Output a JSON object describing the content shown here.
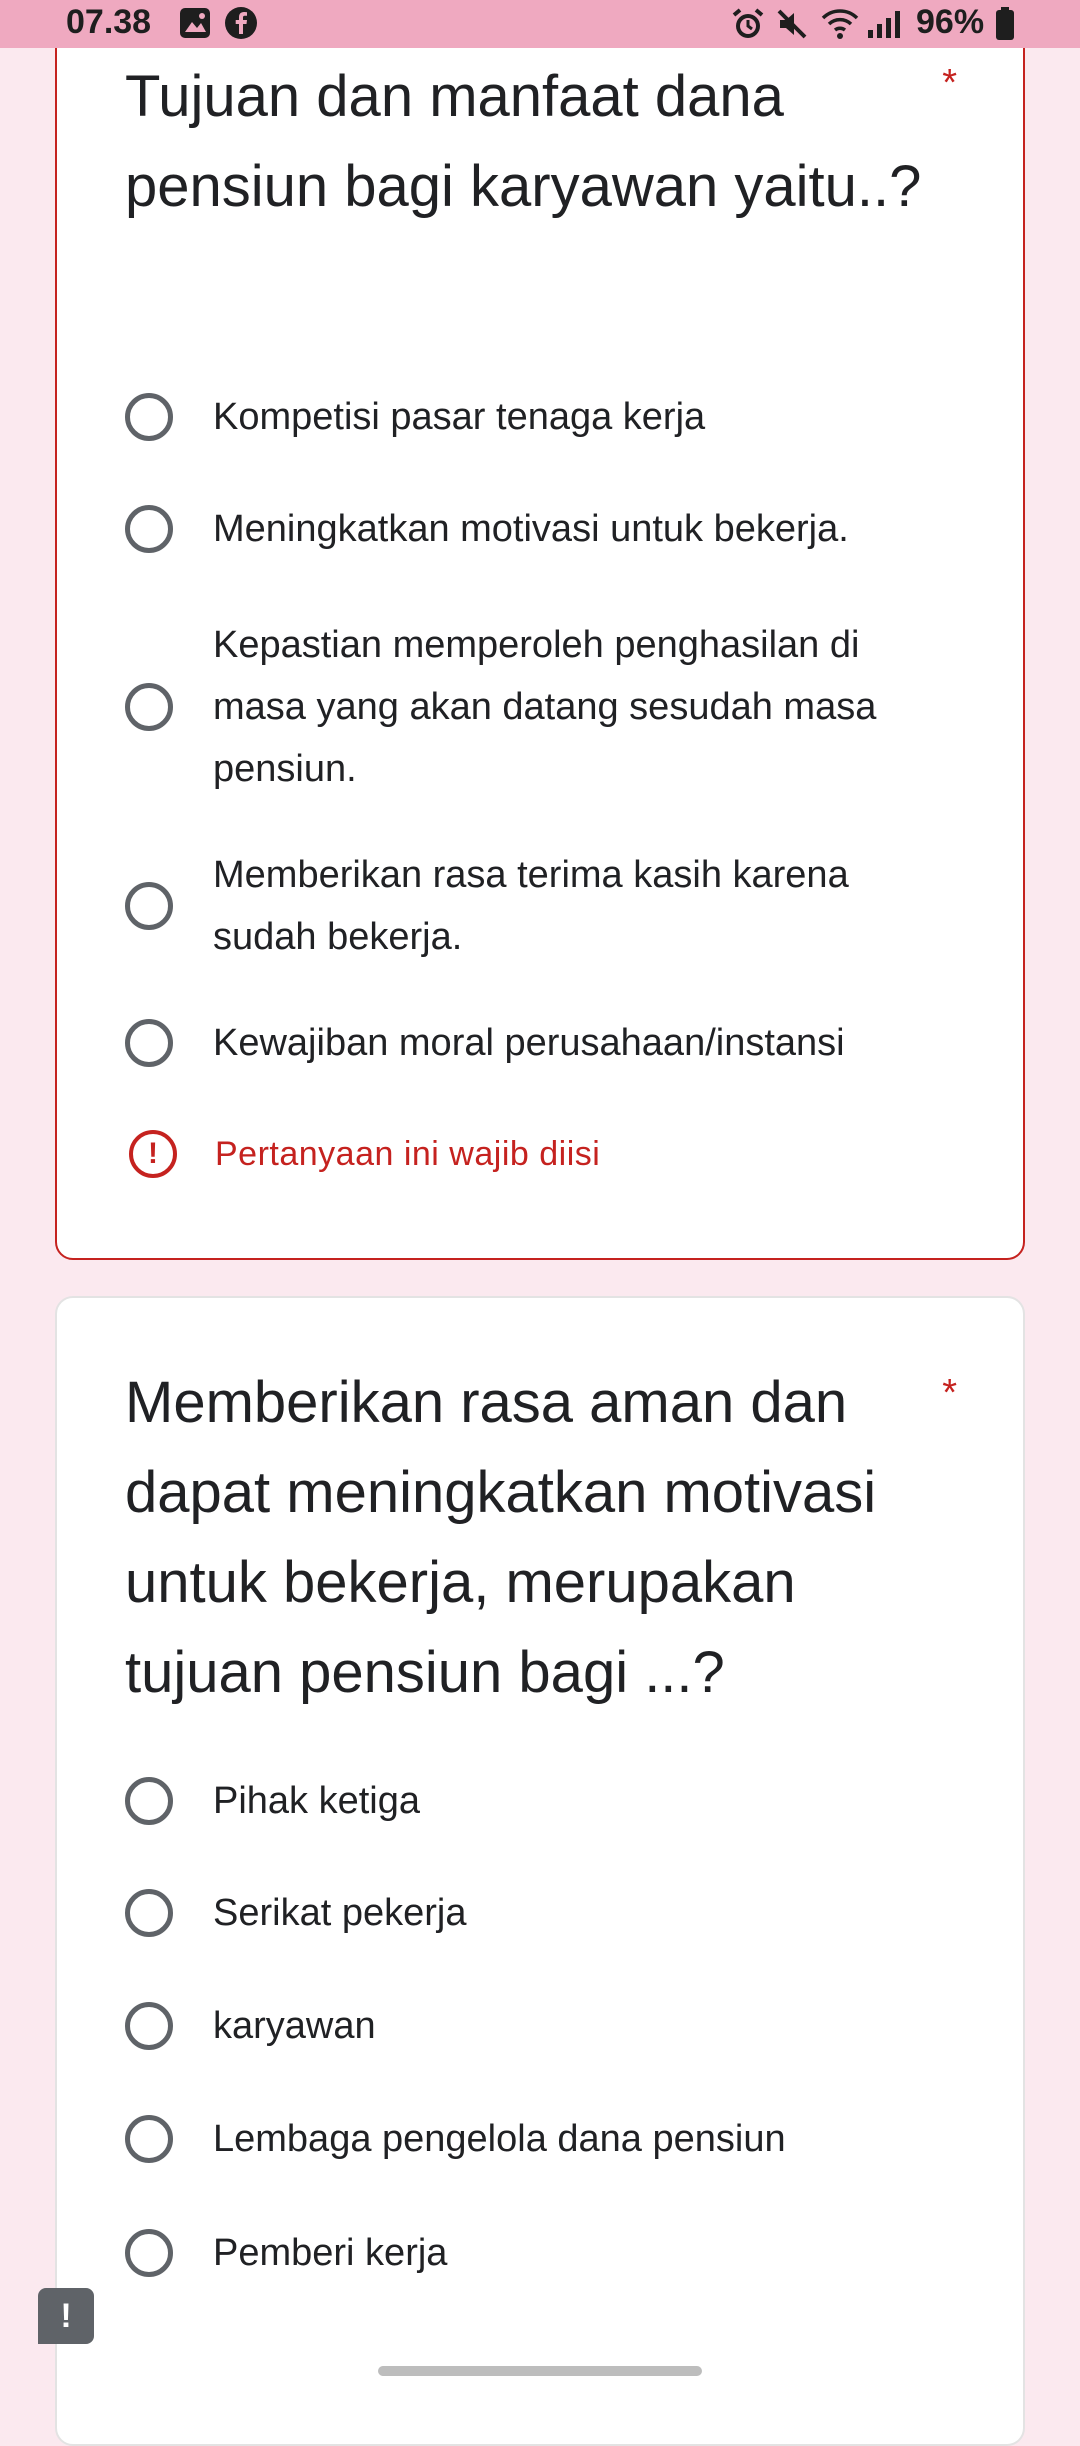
{
  "status_bar": {
    "time": "07.38",
    "battery": "96%",
    "left_icons": [
      "gallery-icon",
      "facebook-icon"
    ],
    "right_icons": [
      "alarm-icon",
      "mute-icon",
      "wifi-icon",
      "signal-icon",
      "battery-icon"
    ]
  },
  "question1": {
    "title": "Tujuan dan manfaat dana pensiun bagi karyawan yaitu..?",
    "required_marker": "*",
    "options": [
      "Kompetisi pasar tenaga kerja",
      "Meningkatkan motivasi untuk bekerja.",
      "Kepastian memperoleh penghasilan di masa yang akan datang sesudah masa pensiun.",
      "Memberikan rasa terima kasih karena sudah bekerja.",
      "Kewajiban moral perusahaan/instansi"
    ],
    "error_icon": "!",
    "error_text": "Pertanyaan ini wajib diisi"
  },
  "question2": {
    "title": "Memberikan rasa aman dan dapat meningkatkan motivasi untuk bekerja, merupakan tujuan pensiun bagi ...?",
    "required_marker": "*",
    "options": [
      "Pihak ketiga",
      "Serikat pekerja",
      "karyawan",
      "Lembaga pengelola dana pensiun",
      "Pemberi kerja"
    ]
  },
  "feedback": {
    "icon_text": "!"
  },
  "colors": {
    "accent_error": "#c5221f",
    "status_bar": "#efa9c0",
    "page_background": "#fbe9ef"
  }
}
